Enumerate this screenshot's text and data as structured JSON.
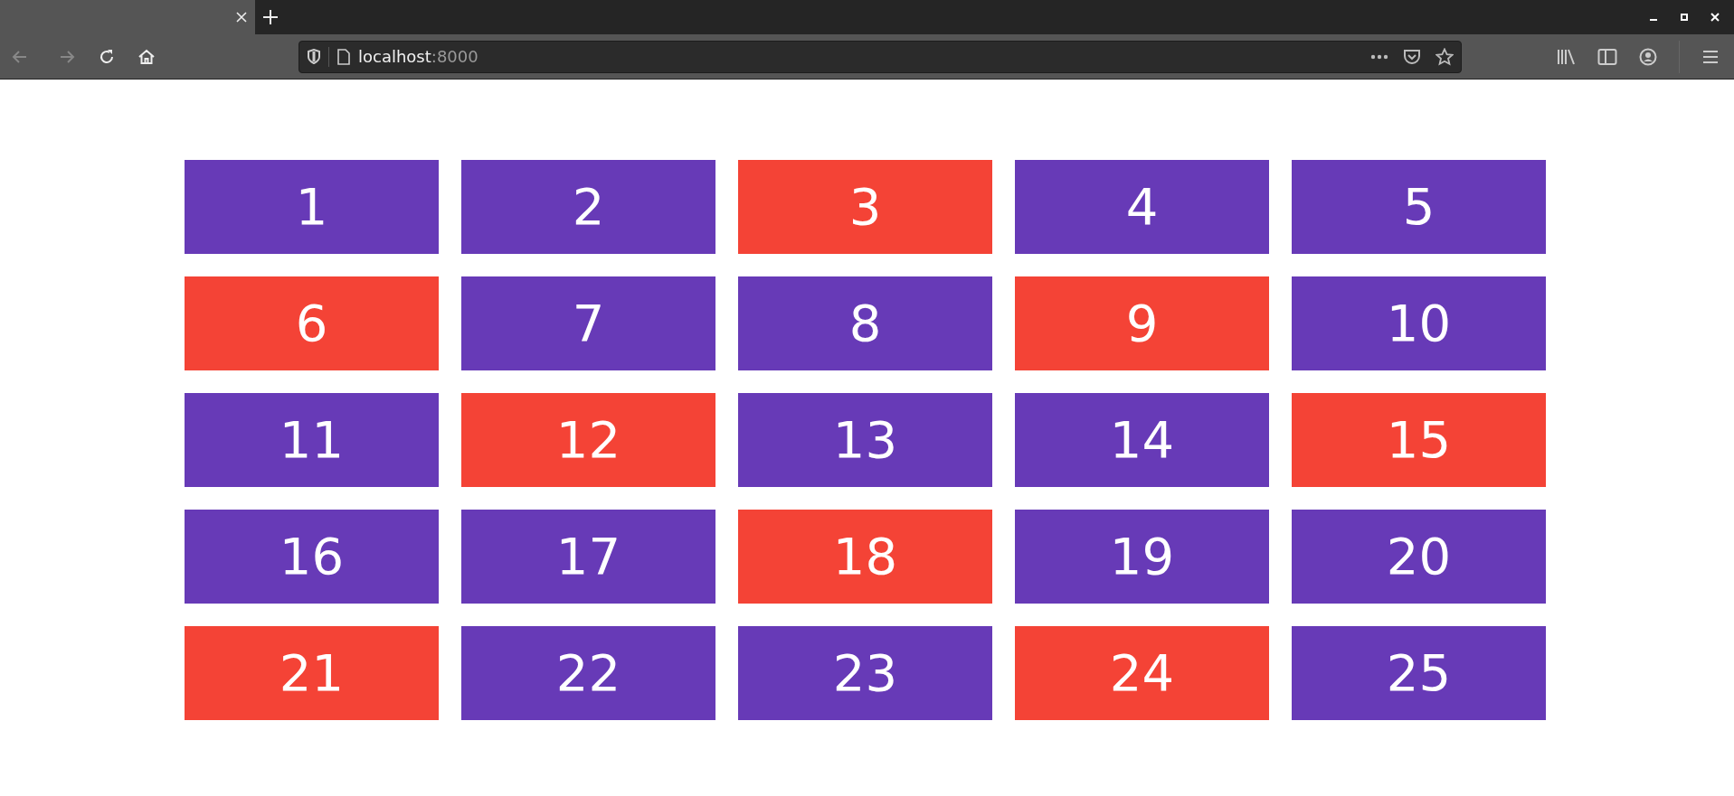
{
  "browser": {
    "address": {
      "host": "localhost",
      "port": ":8000"
    }
  },
  "tiles": [
    {
      "label": "1",
      "color": "#673ab7"
    },
    {
      "label": "2",
      "color": "#673ab7"
    },
    {
      "label": "3",
      "color": "#f44336"
    },
    {
      "label": "4",
      "color": "#673ab7"
    },
    {
      "label": "5",
      "color": "#673ab7"
    },
    {
      "label": "6",
      "color": "#f44336"
    },
    {
      "label": "7",
      "color": "#673ab7"
    },
    {
      "label": "8",
      "color": "#673ab7"
    },
    {
      "label": "9",
      "color": "#f44336"
    },
    {
      "label": "10",
      "color": "#673ab7"
    },
    {
      "label": "11",
      "color": "#673ab7"
    },
    {
      "label": "12",
      "color": "#f44336"
    },
    {
      "label": "13",
      "color": "#673ab7"
    },
    {
      "label": "14",
      "color": "#673ab7"
    },
    {
      "label": "15",
      "color": "#f44336"
    },
    {
      "label": "16",
      "color": "#673ab7"
    },
    {
      "label": "17",
      "color": "#673ab7"
    },
    {
      "label": "18",
      "color": "#f44336"
    },
    {
      "label": "19",
      "color": "#673ab7"
    },
    {
      "label": "20",
      "color": "#673ab7"
    },
    {
      "label": "21",
      "color": "#f44336"
    },
    {
      "label": "22",
      "color": "#673ab7"
    },
    {
      "label": "23",
      "color": "#673ab7"
    },
    {
      "label": "24",
      "color": "#f44336"
    },
    {
      "label": "25",
      "color": "#673ab7"
    }
  ]
}
